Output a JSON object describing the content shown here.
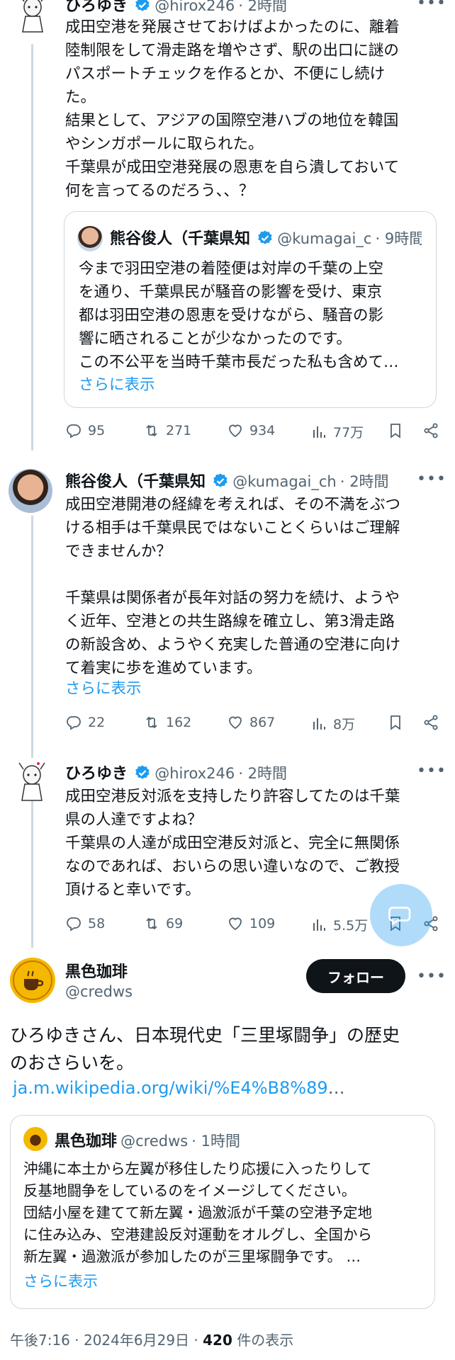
{
  "tweet1": {
    "name": "ひろゆき",
    "handle": "@hirox246",
    "time": "· 2時間",
    "body": "成田空港を発展させておけばよかったのに、離着\n陸制限をして滑走路を増やさず、駅の出口に謎の\nパスポートチェックを作るとか、不便にし続け\nた。\n結果として、アジアの国際空港ハブの地位を韓国\nやシンガポールに取られた。\n千葉県が成田空港発展の恩恵を自ら潰しておいて\n何を言ってるのだろう、、？",
    "quote": {
      "name": "熊谷俊人（千葉県知",
      "handle": "@kumagai_c",
      "time": "· 9時間",
      "body": "今まで羽田空港の着陸便は対岸の千葉の上空\nを通り、千葉県民が騒音の影響を受け、東京\n都は羽田空港の恩恵を受けながら、騒音の影\n響に晒されることが少なかったのです。\nこの不公平を当時千葉市長だった私も含めて…",
      "more": "さらに表示"
    },
    "stats": {
      "replies": "95",
      "retweets": "271",
      "likes": "934",
      "views": "77万"
    }
  },
  "tweet2": {
    "name": "熊谷俊人（千葉県知",
    "handle": "@kumagai_ch",
    "time": "· 2時間",
    "body": "成田空港開港の経緯を考えれば、その不満をぶつ\nける相手は千葉県民ではないことくらいはご理解\nできませんか？\n\n千葉県は関係者が長年対話の努力を続け、ようや\nく近年、空港との共生路線を確立し、第3滑走路\nの新設含め、ようやく充実した普通の空港に向け\nて着実に歩を進めています。",
    "more": "さらに表示",
    "stats": {
      "replies": "22",
      "retweets": "162",
      "likes": "867",
      "views": "8万"
    }
  },
  "tweet3": {
    "name": "ひろゆき",
    "handle": "@hirox246",
    "time": "· 2時間",
    "body": "成田空港反対派を支持したり許容してたのは千葉\n県の人達ですよね？\n千葉県の人達が成田空港反対派と、完全に無関係\nなのであれば、おいらの思い違いなので、ご教授\n頂けると幸いです。",
    "stats": {
      "replies": "58",
      "retweets": "69",
      "likes": "109",
      "views": "5.5万"
    }
  },
  "main": {
    "name": "黒色珈琲",
    "handle": "@credws",
    "follow": "フォロー",
    "body": "ひろゆきさん、日本現代史「三里塚闘争」の歴史\nのおさらいを。",
    "link": "ja.m.wikipedia.org/wiki/%E4%B8%89",
    "link_ellipsis": "…",
    "quote": {
      "name": "黒色珈琲",
      "handle": "@credws",
      "time": "· 1時間",
      "body": "沖縄に本土から左翼が移住したり応援に入ったりして\n反基地闘争をしているのをイメージしてください。\n団結小屋を建てて新左翼・過激派が千葉の空港予定地\nに住み込み、空港建設反対運動をオルグし、全国から\n新左翼・過激派が参加したのが三里塚闘争です。 …",
      "more": "さらに表示"
    },
    "timestamp": "午後7:16 · 2024年6月29日 · ",
    "views_count": "420",
    "views_label": " 件の表示"
  },
  "colors": {
    "accent": "#1d9bf0",
    "text": "#0f1419",
    "muted": "#536471",
    "border": "#cfd9de"
  },
  "icons": [
    "reply-icon",
    "retweet-icon",
    "like-icon",
    "views-icon",
    "bookmark-icon",
    "share-icon",
    "verified-icon",
    "more-icon",
    "compose-icon"
  ]
}
